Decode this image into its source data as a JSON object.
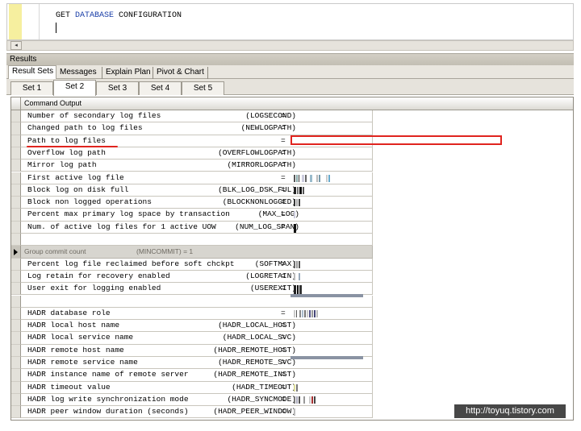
{
  "editor": {
    "code_prefix": "GET ",
    "code_keyword": "DATABASE",
    "code_suffix": " CONFIGURATION"
  },
  "results": {
    "title": "Results",
    "top_tabs": [
      "Result Sets",
      "Messages",
      "Explain Plan",
      "Pivot & Chart"
    ],
    "set_tabs": [
      "Set 1",
      "Set 2",
      "Set 3",
      "Set 4",
      "Set 5"
    ],
    "active_set": "Set 2",
    "column_header": "Command Output"
  },
  "rows": [
    {
      "label": "Number of secondary log files",
      "code": "(LOGSECOND)",
      "eq": "="
    },
    {
      "label": "Changed path to log files",
      "code": "(NEWLOGPATH)",
      "eq": "="
    },
    {
      "label": "Path to log files",
      "code": "",
      "eq": "="
    },
    {
      "label": "Overflow log path",
      "code": "(OVERFLOWLOGPATH)",
      "eq": "="
    },
    {
      "label": "Mirror log path",
      "code": "(MIRRORLOGPATH)",
      "eq": "="
    },
    {
      "label": "First active log file",
      "code": "",
      "eq": "="
    },
    {
      "label": "Block log on disk full",
      "code": "(BLK_LOG_DSK_FUL)",
      "eq": "="
    },
    {
      "label": "Block non logged operations",
      "code": "(BLOCKNONLOGGED)",
      "eq": "="
    },
    {
      "label": "Percent max primary log space by transaction",
      "code": "(MAX_LOG)",
      "eq": "="
    },
    {
      "label": "Num. of active log files for 1 active UOW",
      "code": "(NUM_LOG_SPAN)",
      "eq": "="
    }
  ],
  "group_row": {
    "label": "Group commit count",
    "code": "(MINCOMMIT) = 1"
  },
  "rows2": [
    {
      "label": "Percent log file reclaimed before soft chckpt",
      "code": "(SOFTMAX)",
      "eq": "="
    },
    {
      "label": "Log retain for recovery enabled",
      "code": "(LOGRETAIN)",
      "eq": "="
    },
    {
      "label": "User exit for logging enabled",
      "code": "(USEREXIT)",
      "eq": "="
    }
  ],
  "rows3": [
    {
      "label": "HADR database role",
      "code": "",
      "eq": "="
    },
    {
      "label": "HADR local host name",
      "code": "(HADR_LOCAL_HOST)",
      "eq": "="
    },
    {
      "label": "HADR local service name",
      "code": "(HADR_LOCAL_SVC)",
      "eq": "="
    },
    {
      "label": "HADR remote host name",
      "code": "(HADR_REMOTE_HOST)",
      "eq": "="
    },
    {
      "label": "HADR remote service name",
      "code": "(HADR_REMOTE_SVC)",
      "eq": "="
    },
    {
      "label": "HADR instance name of remote server",
      "code": "(HADR_REMOTE_INST)",
      "eq": "="
    },
    {
      "label": "HADR timeout value",
      "code": "(HADR_TIMEOUT)",
      "eq": "="
    },
    {
      "label": "HADR log write synchronization mode",
      "code": "(HADR_SYNCMODE)",
      "eq": "="
    },
    {
      "label": "HADR peer window duration (seconds)",
      "code": "(HADR_PEER_WINDOW)",
      "eq": "="
    }
  ],
  "watermark": "http://toyuq.tistory.com",
  "colors": {
    "highlight": "#e0241f",
    "keyword": "#1a3fa8"
  }
}
